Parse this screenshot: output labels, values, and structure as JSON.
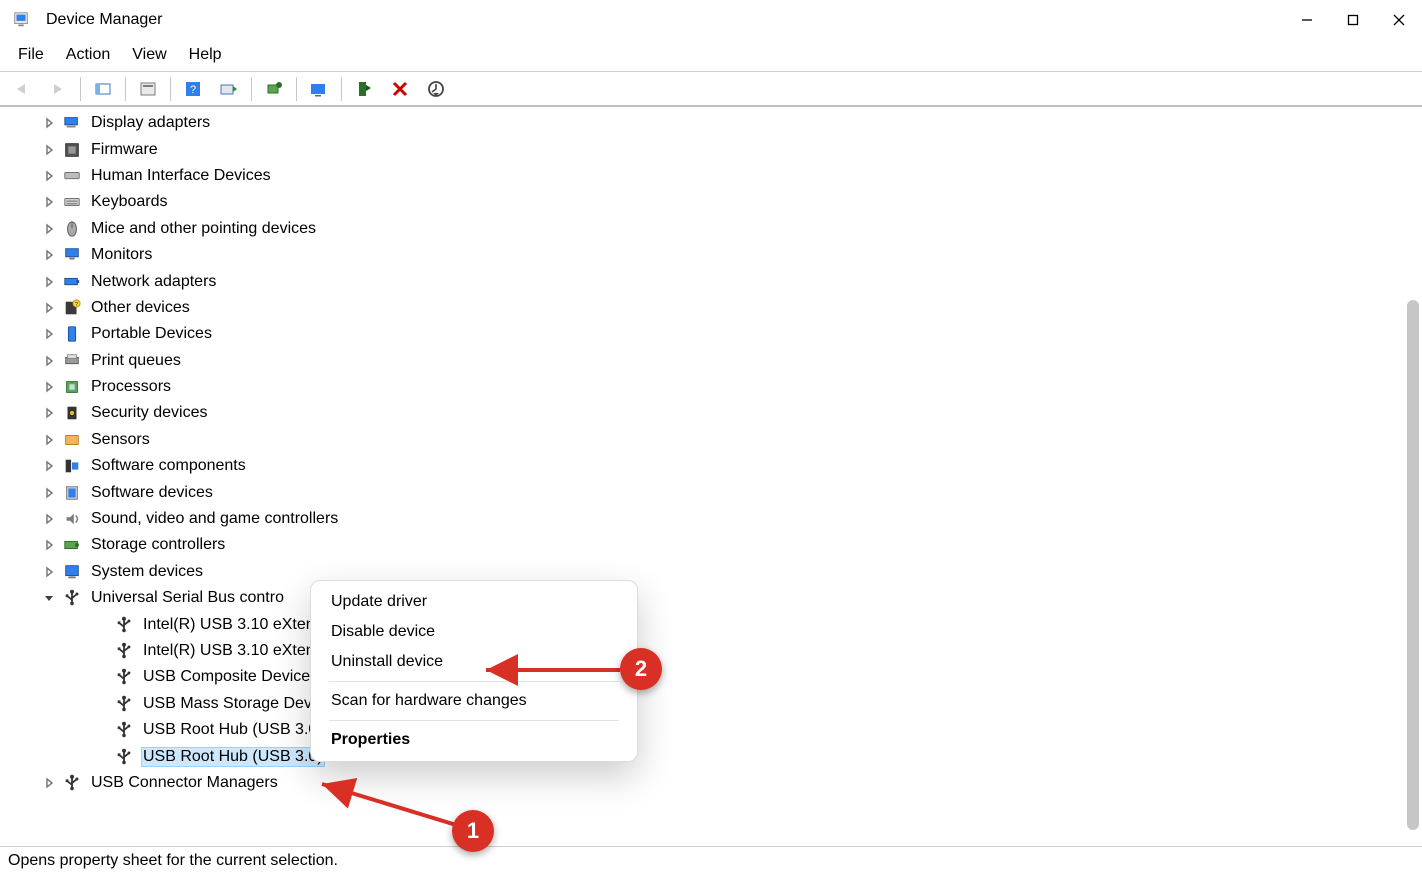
{
  "window": {
    "title": "Device Manager"
  },
  "menubar": {
    "items": [
      "File",
      "Action",
      "View",
      "Help"
    ]
  },
  "tree": {
    "categories": [
      {
        "label": "Display adapters",
        "expanded": false,
        "icon": "display-adapter-icon"
      },
      {
        "label": "Firmware",
        "expanded": false,
        "icon": "firmware-icon"
      },
      {
        "label": "Human Interface Devices",
        "expanded": false,
        "icon": "hid-icon"
      },
      {
        "label": "Keyboards",
        "expanded": false,
        "icon": "keyboard-icon"
      },
      {
        "label": "Mice and other pointing devices",
        "expanded": false,
        "icon": "mouse-icon"
      },
      {
        "label": "Monitors",
        "expanded": false,
        "icon": "monitor-icon"
      },
      {
        "label": "Network adapters",
        "expanded": false,
        "icon": "network-adapter-icon"
      },
      {
        "label": "Other devices",
        "expanded": false,
        "icon": "other-devices-icon"
      },
      {
        "label": "Portable Devices",
        "expanded": false,
        "icon": "portable-device-icon"
      },
      {
        "label": "Print queues",
        "expanded": false,
        "icon": "printer-icon"
      },
      {
        "label": "Processors",
        "expanded": false,
        "icon": "processor-icon"
      },
      {
        "label": "Security devices",
        "expanded": false,
        "icon": "security-device-icon"
      },
      {
        "label": "Sensors",
        "expanded": false,
        "icon": "sensor-icon"
      },
      {
        "label": "Software components",
        "expanded": false,
        "icon": "software-component-icon"
      },
      {
        "label": "Software devices",
        "expanded": false,
        "icon": "software-device-icon"
      },
      {
        "label": "Sound, video and game controllers",
        "expanded": false,
        "icon": "sound-icon"
      },
      {
        "label": "Storage controllers",
        "expanded": false,
        "icon": "storage-controller-icon"
      },
      {
        "label": "System devices",
        "expanded": false,
        "icon": "system-device-icon"
      },
      {
        "label": "Universal Serial Bus contro",
        "expanded": true,
        "icon": "usb-icon",
        "children": [
          {
            "label": "Intel(R) USB 3.10 eXten",
            "selected": false
          },
          {
            "label": "Intel(R) USB 3.10 eXten",
            "selected": false
          },
          {
            "label": "USB Composite Device",
            "selected": false
          },
          {
            "label": "USB Mass Storage Dev",
            "selected": false
          },
          {
            "label": "USB Root Hub (USB 3.0",
            "selected": false
          },
          {
            "label": "USB Root Hub (USB 3.0)",
            "selected": true
          }
        ]
      },
      {
        "label": "USB Connector Managers",
        "expanded": false,
        "icon": "usb-connector-icon"
      }
    ]
  },
  "context_menu": {
    "items": [
      {
        "label": "Update driver",
        "type": "item"
      },
      {
        "label": "Disable device",
        "type": "item"
      },
      {
        "label": "Uninstall device",
        "type": "item"
      },
      {
        "type": "separator"
      },
      {
        "label": "Scan for hardware changes",
        "type": "item"
      },
      {
        "type": "separator"
      },
      {
        "label": "Properties",
        "type": "item",
        "bold": true
      }
    ]
  },
  "statusbar": {
    "text": "Opens property sheet for the current selection."
  },
  "annotations": {
    "badge1": "1",
    "badge2": "2"
  }
}
